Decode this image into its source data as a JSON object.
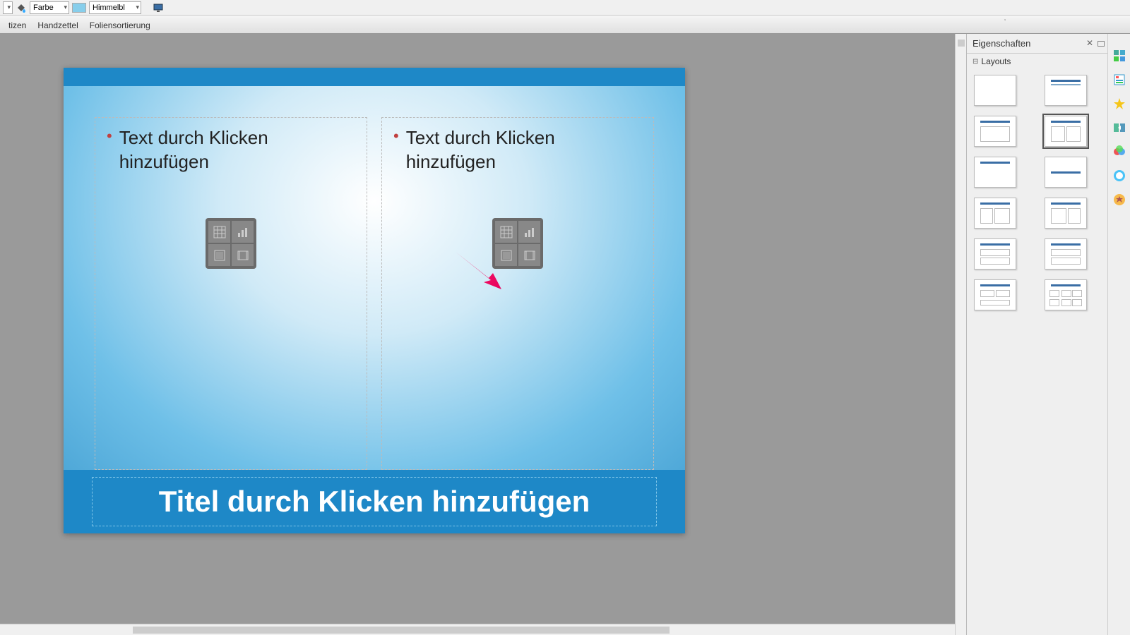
{
  "toolbar": {
    "color_label": "Farbe",
    "color_name": "Himmelbl"
  },
  "viewbar": {
    "tab0": "tizen",
    "tab1": "Handzettel",
    "tab2": "Foliensortierung"
  },
  "slide": {
    "content_placeholder": "Text durch Klicken hinzufügen",
    "title_placeholder": "Titel durch Klicken hinzufügen"
  },
  "panel": {
    "title": "Eigenschaften",
    "section": "Layouts"
  }
}
